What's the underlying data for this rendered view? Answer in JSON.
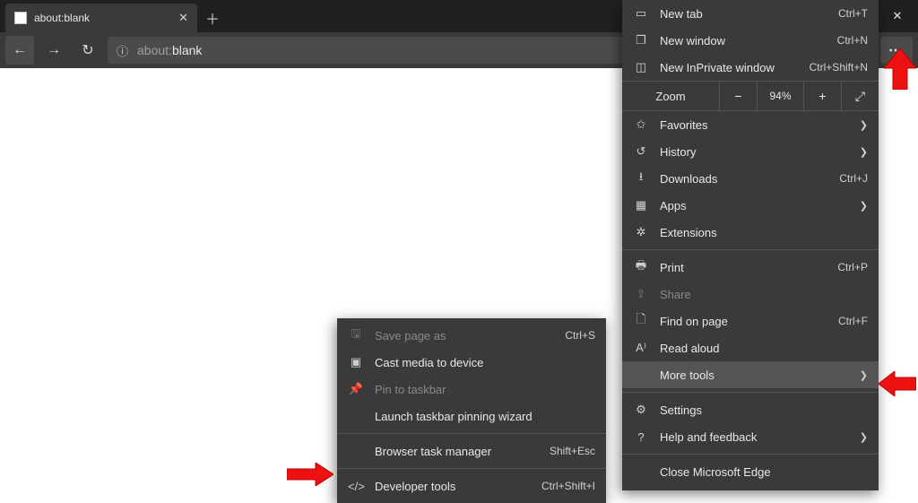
{
  "tab": {
    "title": "about:blank"
  },
  "url": {
    "prefix": "about:",
    "rest": "blank"
  },
  "zoom": {
    "label": "Zoom",
    "value": "94%"
  },
  "menu": {
    "newTab": {
      "label": "New tab",
      "shortcut": "Ctrl+T"
    },
    "newWindow": {
      "label": "New window",
      "shortcut": "Ctrl+N"
    },
    "newInPrivate": {
      "label": "New InPrivate window",
      "shortcut": "Ctrl+Shift+N"
    },
    "favorites": {
      "label": "Favorites"
    },
    "history": {
      "label": "History"
    },
    "downloads": {
      "label": "Downloads",
      "shortcut": "Ctrl+J"
    },
    "apps": {
      "label": "Apps"
    },
    "extensions": {
      "label": "Extensions"
    },
    "print": {
      "label": "Print",
      "shortcut": "Ctrl+P"
    },
    "share": {
      "label": "Share"
    },
    "find": {
      "label": "Find on page",
      "shortcut": "Ctrl+F"
    },
    "readAloud": {
      "label": "Read aloud"
    },
    "moreTools": {
      "label": "More tools"
    },
    "settings": {
      "label": "Settings"
    },
    "help": {
      "label": "Help and feedback"
    },
    "close": {
      "label": "Close Microsoft Edge"
    }
  },
  "submenu": {
    "savePage": {
      "label": "Save page as",
      "shortcut": "Ctrl+S"
    },
    "cast": {
      "label": "Cast media to device"
    },
    "pin": {
      "label": "Pin to taskbar"
    },
    "pinWizard": {
      "label": "Launch taskbar pinning wizard"
    },
    "taskmgr": {
      "label": "Browser task manager",
      "shortcut": "Shift+Esc"
    },
    "devtools": {
      "label": "Developer tools",
      "shortcut": "Ctrl+Shift+I"
    }
  }
}
